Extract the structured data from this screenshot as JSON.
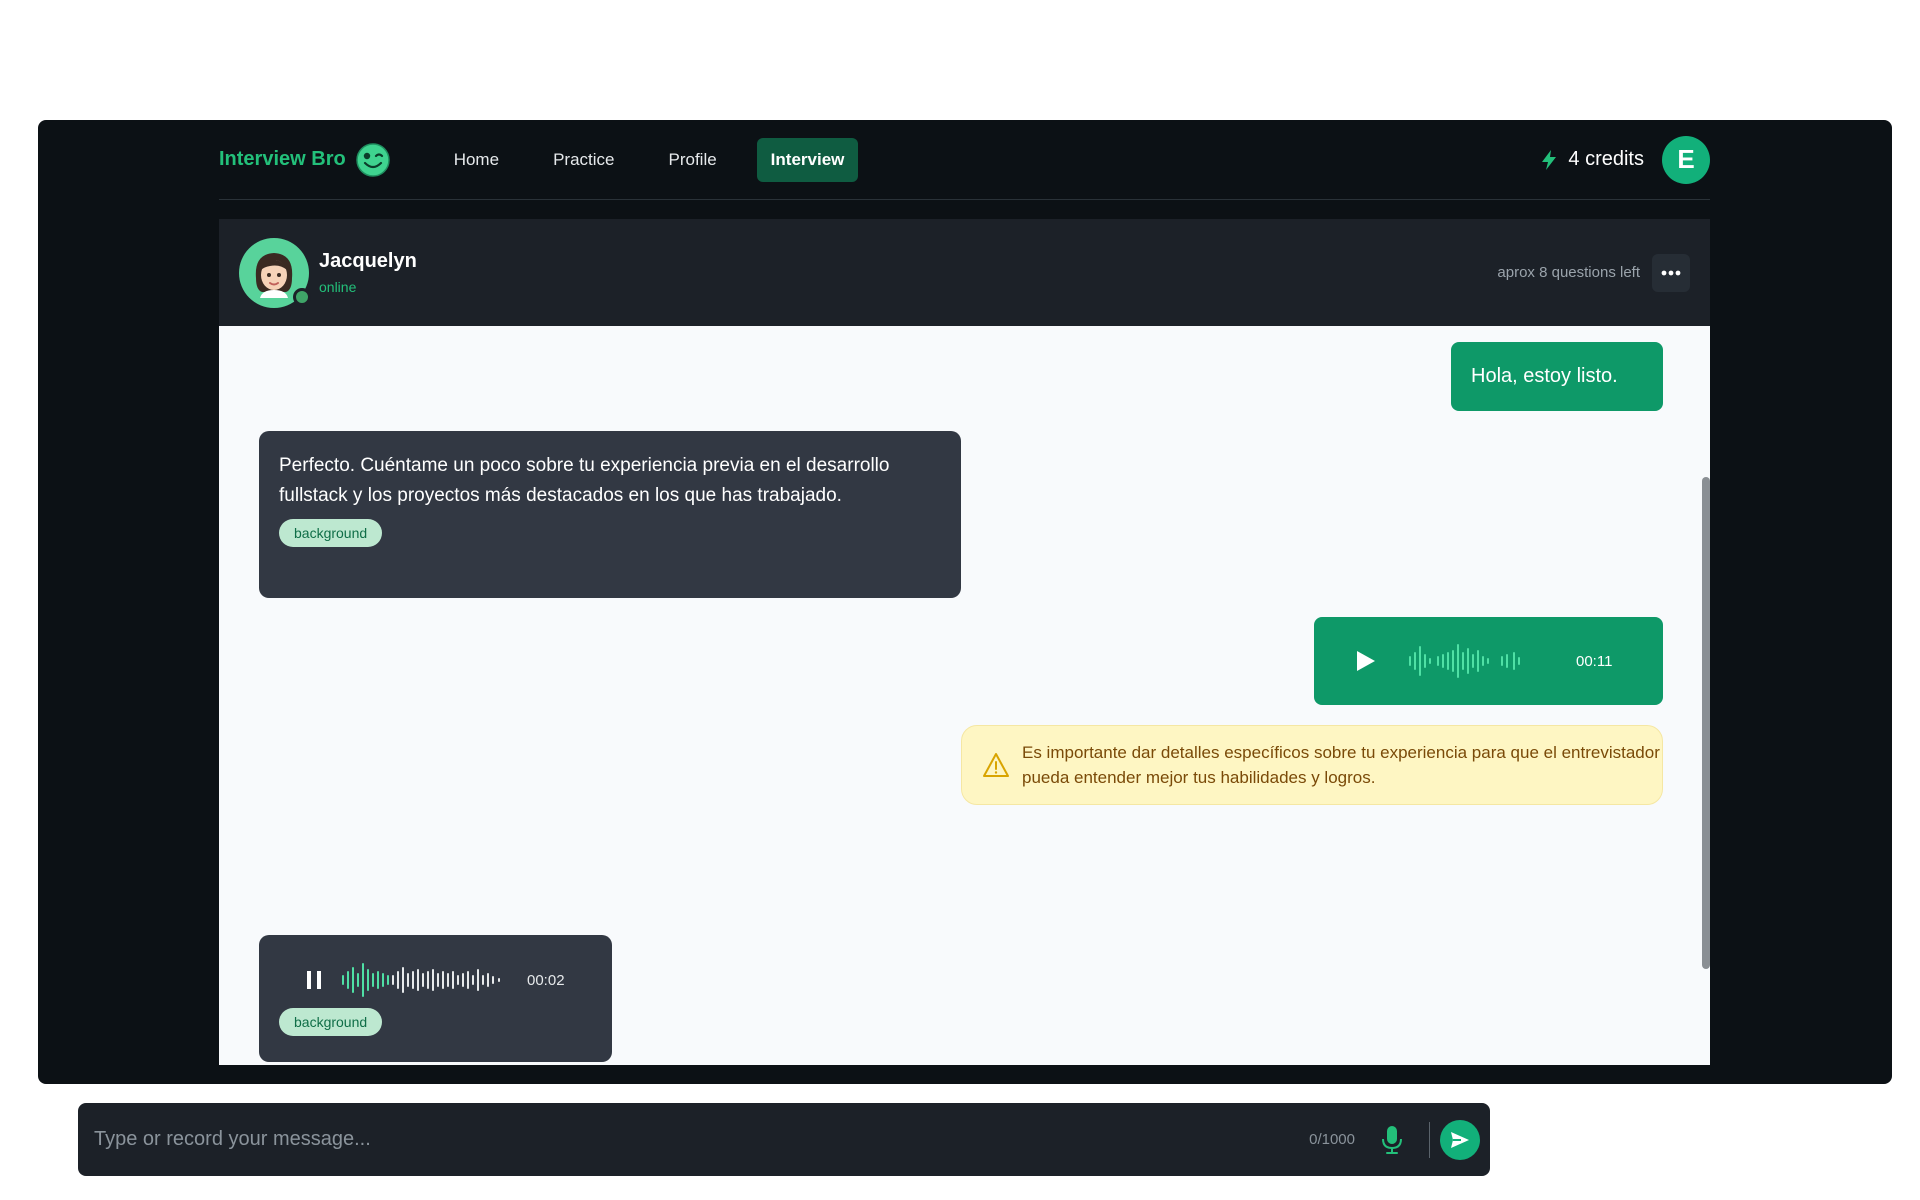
{
  "app": {
    "brand_name": "Interview Bro",
    "nav": [
      "Home",
      "Practice",
      "Profile",
      "Interview"
    ],
    "active_nav": "Interview",
    "credits": "4 credits",
    "user_initial": "E"
  },
  "colors": {
    "brand": "#23c07a",
    "user_bubble": "#0e9968",
    "bot_bubble": "#323843",
    "warning_bg": "#fef6c3"
  },
  "chat": {
    "interviewer_name": "Jacquelyn",
    "interviewer_status": "online",
    "questions_left": "aprox 8 questions left",
    "messages": [
      {
        "role": "user",
        "type": "text",
        "text": "Hola, estoy listo."
      },
      {
        "role": "bot",
        "type": "text",
        "text": "Perfecto. Cuéntame un poco sobre tu experiencia previa en el desarrollo fullstack y los proyectos más destacados en los que has trabajado.",
        "tag": "background"
      },
      {
        "role": "user",
        "type": "audio",
        "duration": "00:11",
        "state": "paused"
      },
      {
        "role": "system",
        "type": "warning",
        "text": "Es importante dar detalles específicos sobre tu experiencia para que el entrevistador pueda entender mejor tus habilidades y logros."
      },
      {
        "role": "bot",
        "type": "audio",
        "duration": "00:02",
        "state": "playing",
        "tag": "background"
      }
    ]
  },
  "input": {
    "placeholder": "Type or record your message...",
    "char_count": "0/1000"
  },
  "icons": {
    "brand": "winking-face-icon",
    "credits": "lightning-bolt-icon",
    "more": "ellipsis-icon",
    "play": "play-icon",
    "pause": "pause-icon",
    "warning": "warning-triangle-icon",
    "mic": "microphone-icon",
    "send": "send-arrow-icon"
  }
}
